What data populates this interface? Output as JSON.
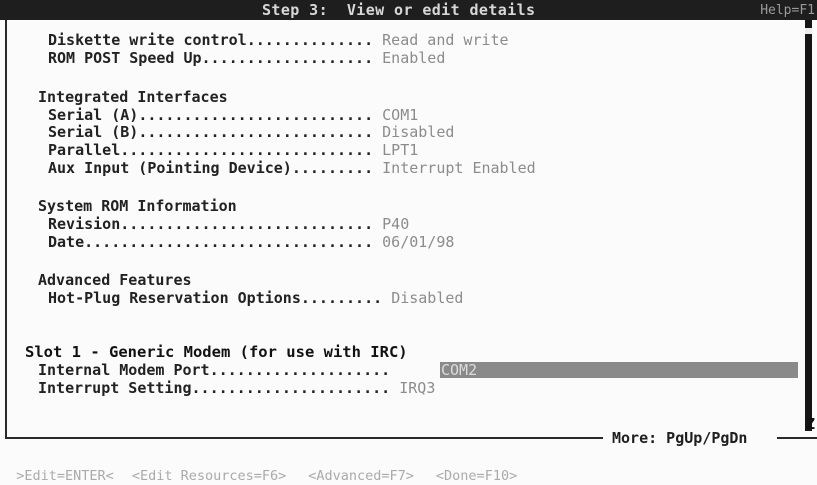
{
  "header": {
    "title": "Step 3:  View or edit details",
    "help": "Help=F1"
  },
  "settings": [
    {
      "label": "Diskette write control",
      "dots": "..............",
      "value": "Read and write"
    },
    {
      "label": "ROM POST Speed Up",
      "dots": "...................",
      "value": "Enabled"
    }
  ],
  "integrated_interfaces": {
    "heading": "Integrated Interfaces",
    "items": [
      {
        "label": "Serial (A)",
        "dots": "..........................",
        "value": "COM1"
      },
      {
        "label": "Serial (B)",
        "dots": "..........................",
        "value": "Disabled"
      },
      {
        "label": "Parallel",
        "dots": "............................",
        "value": "LPT1"
      },
      {
        "label": "Aux Input (Pointing Device)",
        "dots": ".........",
        "value": "Interrupt Enabled"
      }
    ]
  },
  "system_rom": {
    "heading": "System ROM Information",
    "items": [
      {
        "label": "Revision",
        "dots": "............................",
        "value": "P40"
      },
      {
        "label": "Date",
        "dots": "................................",
        "value": "06/01/98"
      }
    ]
  },
  "advanced": {
    "heading": "Advanced Features",
    "items": [
      {
        "label": "Hot-Plug Reservation Options",
        "dots": ".........",
        "value": "Disabled"
      }
    ]
  },
  "slot": {
    "heading": "Slot 1 - Generic Modem (for use with IRC)",
    "items": [
      {
        "label": "Internal Modem Port",
        "dots": "....................",
        "value": "COM2"
      },
      {
        "label": "Interrupt Setting",
        "dots": "......................",
        "value": "IRQ3"
      }
    ]
  },
  "scroll_hint": "More: PgUp/PgDn",
  "zoom_marker": "Z",
  "function_keys": [
    ">Edit=ENTER<",
    "<Edit Resources=F6>",
    "<Advanced=F7>",
    "<Done=F10>"
  ]
}
